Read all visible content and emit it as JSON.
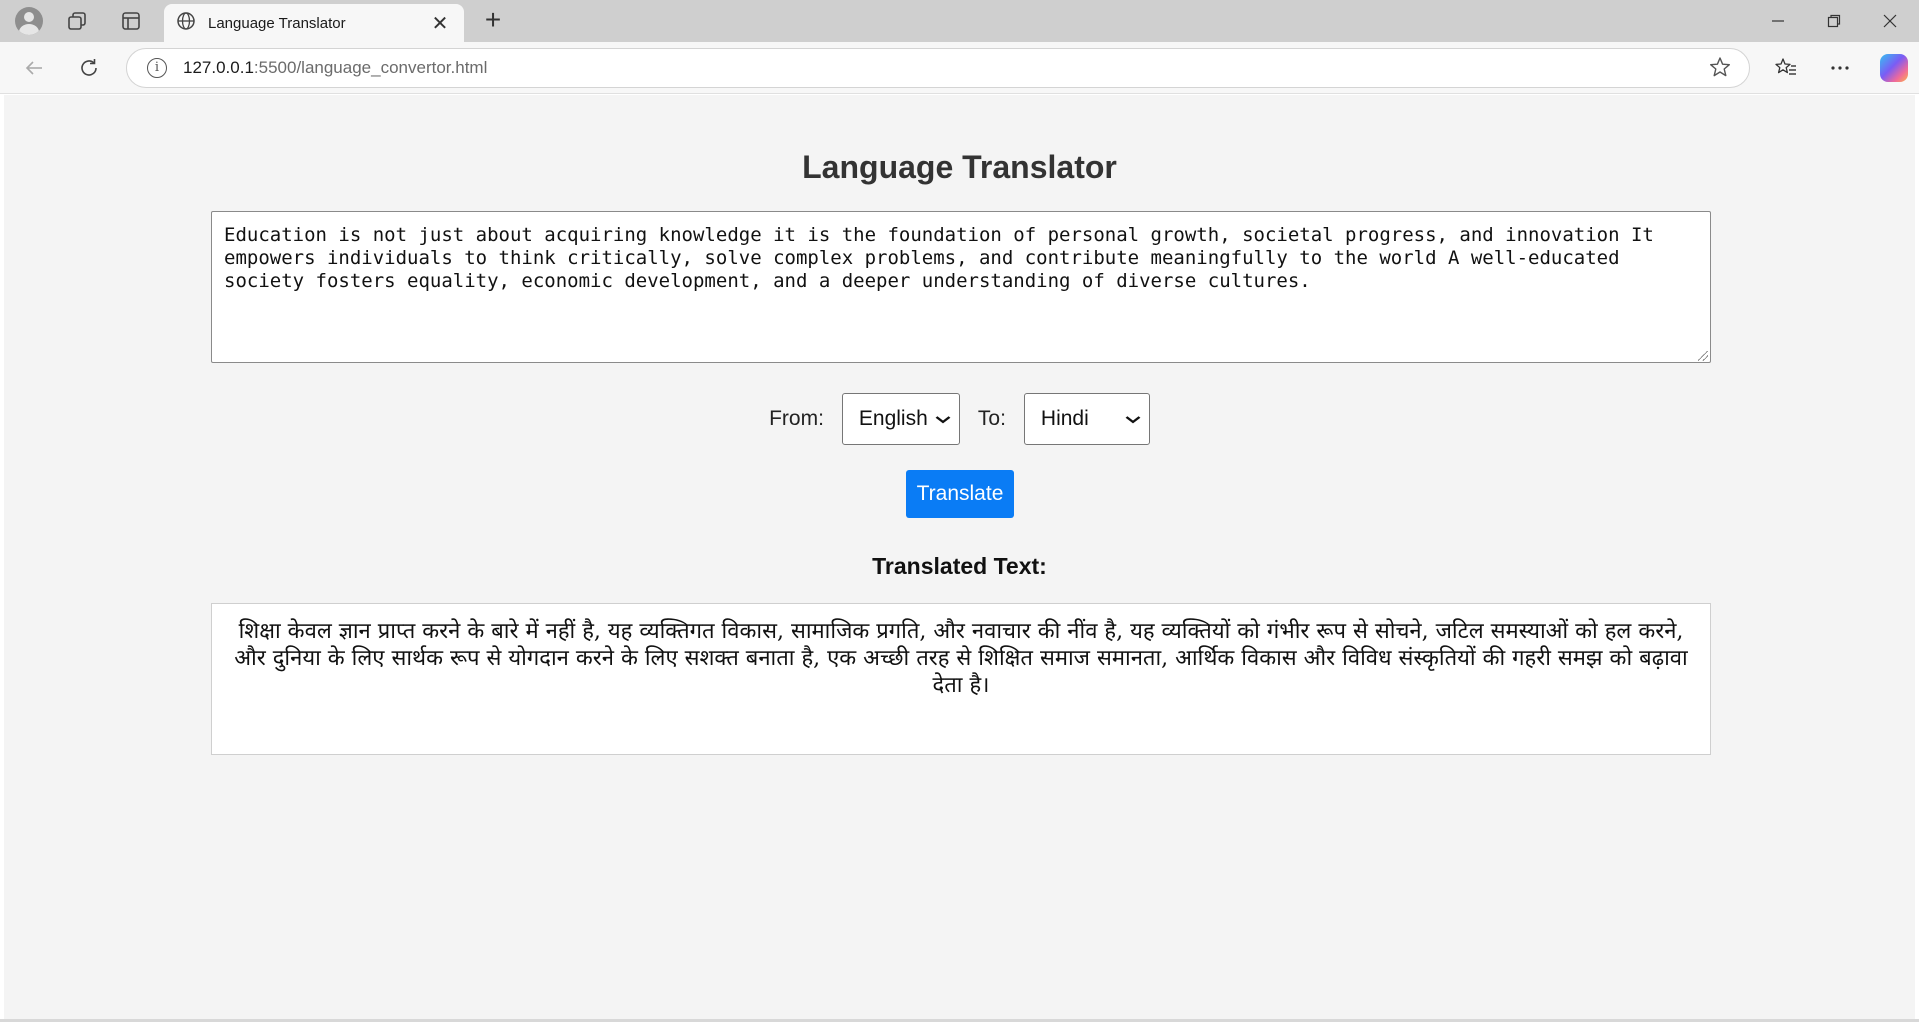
{
  "browser": {
    "tab_title": "Language Translator",
    "url_host": "127.0.0.1",
    "url_path": ":5500/language_convertor.html",
    "new_tab_glyph": "+",
    "close_glyph": "✕"
  },
  "page": {
    "title": "Language Translator",
    "source_text": "Education is not just about acquiring knowledge it is the foundation of personal growth, societal progress, and innovation It empowers individuals to think critically, solve complex problems, and contribute meaningfully to the world A well-educated society fosters equality, economic development, and a deeper understanding of diverse cultures.",
    "from_label": "From:",
    "from_value": "English",
    "to_label": "To:",
    "to_value": "Hindi",
    "translate_label": "Translate",
    "output_heading": "Translated Text:",
    "output_text": "शिक्षा केवल ज्ञान प्राप्त करने के बारे में नहीं है, यह व्यक्तिगत विकास, सामाजिक प्रगति, और नवाचार की नींव है, यह व्यक्तियों को गंभीर रूप से सोचने, जटिल समस्याओं को हल करने, और दुनिया के लिए सार्थक रूप से योगदान करने के लिए सशक्त बनाता है, एक अच्छी तरह से शिक्षित समाज समानता, आर्थिक विकास और विविध संस्कृतियों की गहरी समझ को बढ़ावा देता है।"
  },
  "colors": {
    "accent": "#0a7cf5",
    "page_bg": "#f4f4f4",
    "title": "#333333"
  },
  "icons": [
    "profile-avatar-icon",
    "workspaces-icon",
    "tab-actions-icon",
    "globe-icon",
    "close-icon",
    "new-tab-icon",
    "minimize-icon",
    "restore-icon",
    "window-close-icon",
    "back-icon",
    "refresh-icon",
    "info-icon",
    "favorite-star-icon",
    "favorites-icon",
    "more-icon",
    "copilot-icon"
  ]
}
